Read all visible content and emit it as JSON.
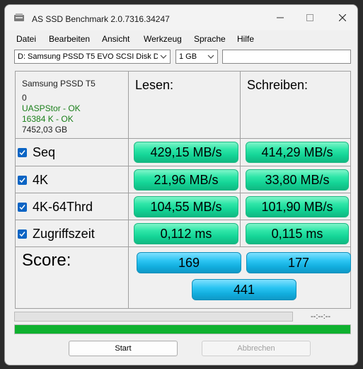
{
  "window": {
    "title": "AS SSD Benchmark 2.0.7316.34247"
  },
  "menu": [
    "Datei",
    "Bearbeiten",
    "Ansicht",
    "Werkzeug",
    "Sprache",
    "Hilfe"
  ],
  "toolbar": {
    "drive": "D: Samsung PSSD T5 EVO SCSI Disk De",
    "size": "1 GB",
    "text": ""
  },
  "info": {
    "model": "Samsung PSSD T5",
    "line2": "0",
    "driver": "UASPStor - OK",
    "align": "16384 K - OK",
    "capacity": "7452,03 GB"
  },
  "headers": {
    "read": "Lesen:",
    "write": "Schreiben:"
  },
  "rows": [
    {
      "label": "Seq",
      "checked": true,
      "read": "429,15 MB/s",
      "write": "414,29 MB/s"
    },
    {
      "label": "4K",
      "checked": true,
      "read": "21,96 MB/s",
      "write": "33,80 MB/s"
    },
    {
      "label": "4K-64Thrd",
      "checked": true,
      "read": "104,55 MB/s",
      "write": "101,90 MB/s"
    },
    {
      "label": "Zugriffszeit",
      "checked": true,
      "read": "0,112 ms",
      "write": "0,115 ms"
    }
  ],
  "score": {
    "label": "Score:",
    "read": "169",
    "write": "177",
    "total": "441"
  },
  "progress": {
    "time": "--:--:--",
    "bar1": 0,
    "bar2": 1.0
  },
  "buttons": {
    "start": "Start",
    "cancel": "Abbrechen"
  },
  "colors": {
    "green": "#2ee6a8",
    "blue": "#2bc4f2",
    "progress": "#0fb12f",
    "ok_text": "#1a7f1a"
  }
}
